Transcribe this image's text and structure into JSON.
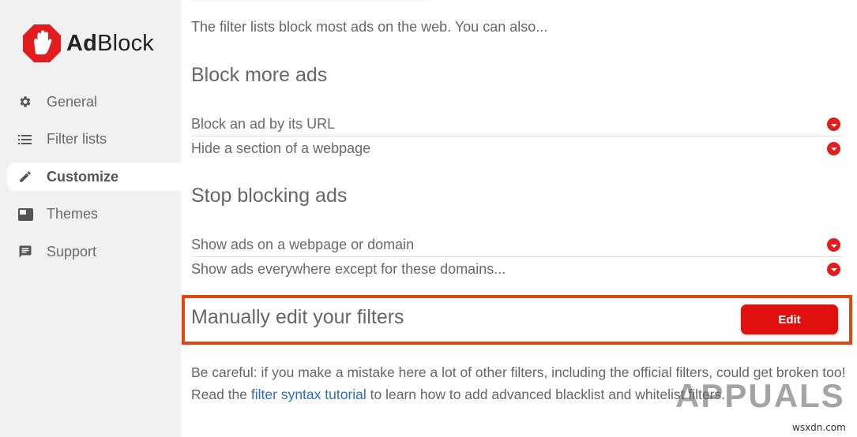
{
  "app": {
    "brand_prefix": "Ad",
    "brand_suffix": "Block",
    "brand_color": "#e31d1d"
  },
  "sidebar": {
    "items": [
      {
        "label": "General",
        "icon": "gear-icon",
        "active": false
      },
      {
        "label": "Filter lists",
        "icon": "list-icon",
        "active": false
      },
      {
        "label": "Customize",
        "icon": "pencil-icon",
        "active": true
      },
      {
        "label": "Themes",
        "icon": "themes-icon",
        "active": false
      },
      {
        "label": "Support",
        "icon": "chat-icon",
        "active": false
      }
    ]
  },
  "main": {
    "intro": "The filter lists block most ads on the web. You can also...",
    "block_more": {
      "title": "Block more ads",
      "items": [
        "Block an ad by its URL",
        "Hide a section of a webpage"
      ]
    },
    "stop_blocking": {
      "title": "Stop blocking ads",
      "items": [
        "Show ads on a webpage or domain",
        "Show ads everywhere except for these domains..."
      ]
    },
    "manual": {
      "title": "Manually edit your filters",
      "edit_label": "Edit",
      "highlight_color": "#e5450e"
    },
    "warning": {
      "line1": "Be careful: if you make a mistake here a lot of other filters, including the official filters, could get broken too!",
      "read_prefix": "Read the ",
      "link_text": "filter syntax tutorial",
      "read_suffix": " to learn how to add advanced blacklist and whitelist filters."
    }
  },
  "watermark": {
    "text": "APPUALS",
    "domain": "wsxdn.com"
  }
}
